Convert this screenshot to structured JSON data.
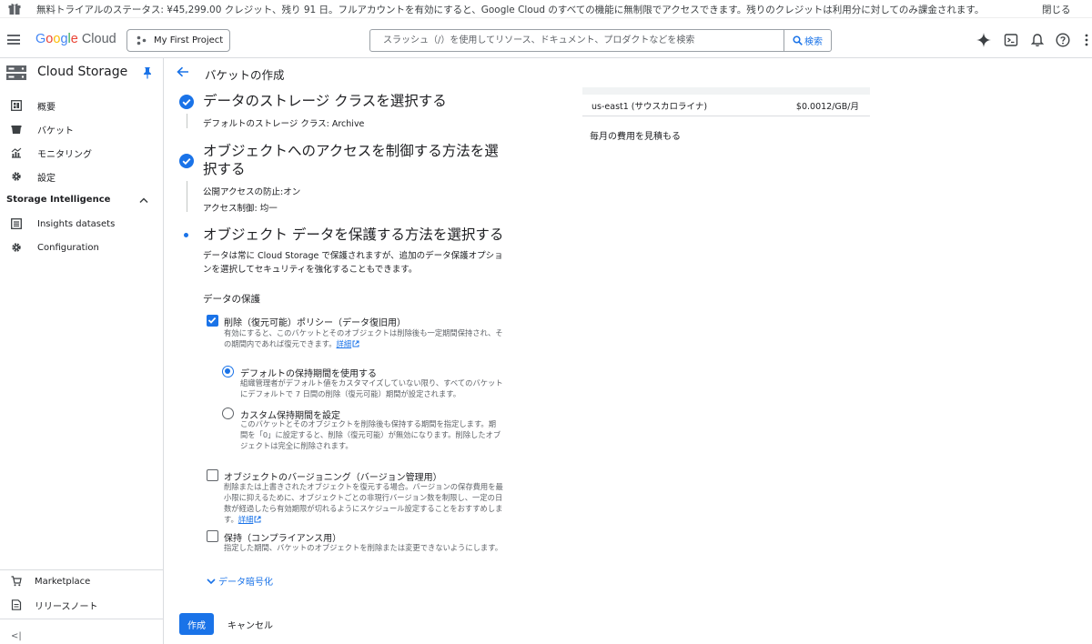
{
  "banner": {
    "text": "無料トライアルのステータス: ¥45,299.00 クレジット、残り 91 日。フルアカウントを有効にすると、Google Cloud のすべての機能に無制限でアクセスできます。残りのクレジットは利用分に対してのみ課金されます。",
    "close_label": "閉じる"
  },
  "header": {
    "logo": {
      "g": "G",
      "o1": "o",
      "o2": "o",
      "g2": "g",
      "l": "l",
      "e": "e",
      "cloud": "Cloud"
    },
    "project": "My First Project",
    "search_placeholder": "スラッシュ（/）を使用してリソース、ドキュメント、プロダクトなどを検索",
    "search_button": "検索"
  },
  "sidebar": {
    "title": "Cloud Storage",
    "items": [
      {
        "label": "概要",
        "icon": "dashboard-icon"
      },
      {
        "label": "バケット",
        "icon": "bucket-icon"
      },
      {
        "label": "モニタリング",
        "icon": "monitoring-icon"
      },
      {
        "label": "設定",
        "icon": "settings-icon"
      }
    ],
    "section": "Storage Intelligence",
    "section_items": [
      {
        "label": "Insights datasets",
        "icon": "dataset-icon"
      },
      {
        "label": "Configuration",
        "icon": "settings-icon"
      }
    ],
    "bottom_items": [
      {
        "label": "Marketplace",
        "icon": "cart-icon"
      },
      {
        "label": "リリースノート",
        "icon": "notes-icon"
      }
    ],
    "collapse": "<|"
  },
  "page": {
    "title": "バケットの作成",
    "steps": {
      "storage_class": {
        "title": "データのストレージ クラスを選択する",
        "summary": "デフォルトのストレージ クラス: Archive"
      },
      "access": {
        "title_line1": "オブジェクトへのアクセスを制御する方法を選",
        "title_line2": "択する",
        "summary1": "公開アクセスの防止:オン",
        "summary2": "アクセス制御: 均一"
      },
      "protection": {
        "title": "オブジェクト データを保護する方法を選択する",
        "desc_line1": "データは常に Cloud Storage で保護されますが、追加のデータ保護オプショ",
        "desc_line2": "ンを選択してセキュリティを強化することもできます。",
        "section_label": "データの保護",
        "soft_delete": {
          "label": "削除（復元可能）ポリシー（データ復旧用）",
          "desc_line1": "有効にすると、このバケットとそのオブジェクトは削除後も一定期間保持され、そ",
          "desc_line2": "の期間内であれば復元できます。",
          "link": "詳細",
          "checked": true
        },
        "default_retention": {
          "label": "デフォルトの保持期間を使用する",
          "desc_line1": "組織管理者がデフォルト値をカスタマイズしていない限り、すべてのバケット",
          "desc_line2": "にデフォルトで 7 日間の削除（復元可能）期間が設定されます。",
          "selected": true
        },
        "custom_retention": {
          "label": "カスタム保持期間を設定",
          "desc_line1": "このバケットとそのオブジェクトを削除後も保持する期間を指定します。期",
          "desc_line2": "間を「0」に設定すると、削除（復元可能）が無効になります。削除したオブ",
          "desc_line3": "ジェクトは完全に削除されます。",
          "selected": false
        },
        "versioning": {
          "label": "オブジェクトのバージョニング（バージョン管理用）",
          "desc_line1": "削除または上書きされたオブジェクトを復元する場合。バージョンの保存費用を最",
          "desc_line2": "小限に抑えるために、オブジェクトごとの非現行バージョン数を制限し、一定の日",
          "desc_line3": "数が経過したら有効期限が切れるようにスケジュール設定することをおすすめしま",
          "desc_line4": "す。",
          "link": "詳細",
          "checked": false
        },
        "retention": {
          "label": "保持（コンプライアンス用）",
          "desc": "指定した期間、バケットのオブジェクトを削除または変更できないようにします。",
          "checked": false
        },
        "encryption": "データ暗号化"
      }
    },
    "create_button": "作成",
    "cancel_button": "キャンセル"
  },
  "pricing": {
    "region": "us-east1 (サウスカロライナ)",
    "price": "$0.0012/GB/月",
    "estimate_link": "毎月の費用を見積もる"
  },
  "colors": {
    "accent": "#1a73e8",
    "text": "#202124",
    "muted": "#5f6368",
    "border": "#dadce0"
  }
}
